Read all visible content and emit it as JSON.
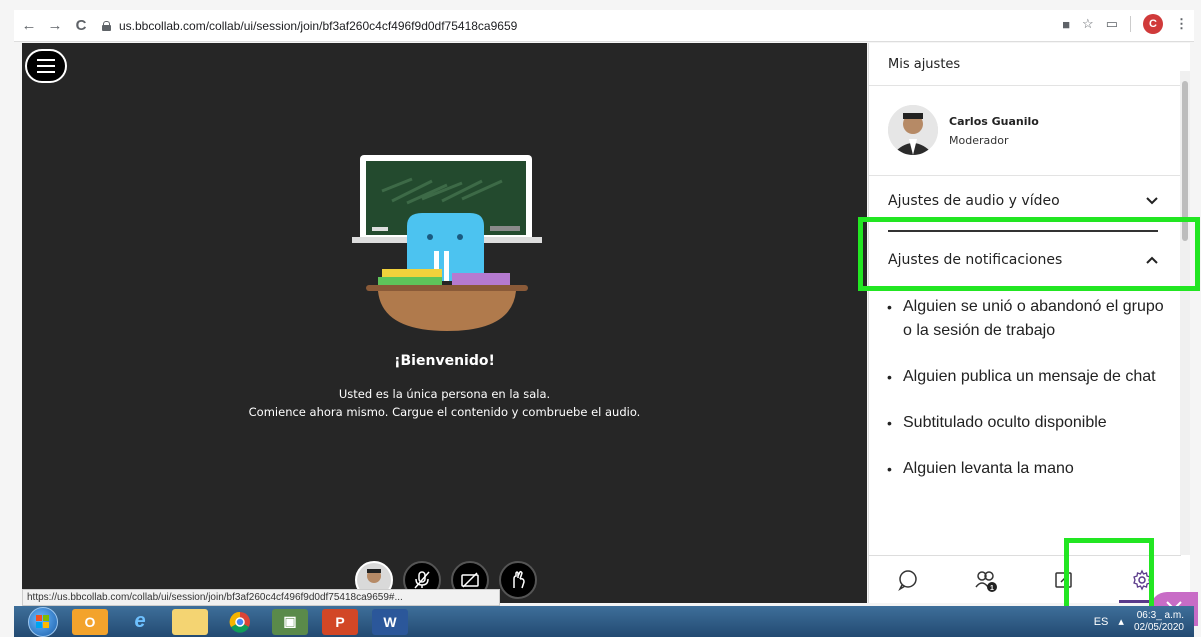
{
  "browser": {
    "url": "us.bbcollab.com/collab/ui/session/join/bf3af260c4cf496f9d0df75418ca9659",
    "profile_initial": "C",
    "status_url": "https://us.bbcollab.com/collab/ui/session/join/bf3af260c4cf496f9d0df75418ca9659#..."
  },
  "stage": {
    "welcome_title": "¡Bienvenido!",
    "welcome_line1": "Usted es la única persona en la sala.",
    "welcome_line2": "Comience ahora mismo. Cargue el contenido y combruebe el audio."
  },
  "panel": {
    "title": "Mis ajustes",
    "user_name": "Carlos Guanilo",
    "user_role": "Moderador",
    "audio_video_label": "Ajustes de audio y vídeo",
    "notifications_label": "Ajustes de notificaciones",
    "notifications": [
      "Alguien se unió o abandonó el grupo o la sesión de trabajo",
      "Alguien publica un mensaje de chat",
      "Subtitulado oculto disponible",
      "Alguien levanta la mano"
    ],
    "participants_badge": "1"
  },
  "taskbar": {
    "language": "ES",
    "time": "06:3_ a.m.",
    "date": "02/05/2020"
  },
  "colors": {
    "highlight": "#22e622",
    "stage_bg": "#262626",
    "accent_purple": "#5a3a8a",
    "close_pill": "#c86cc6"
  }
}
